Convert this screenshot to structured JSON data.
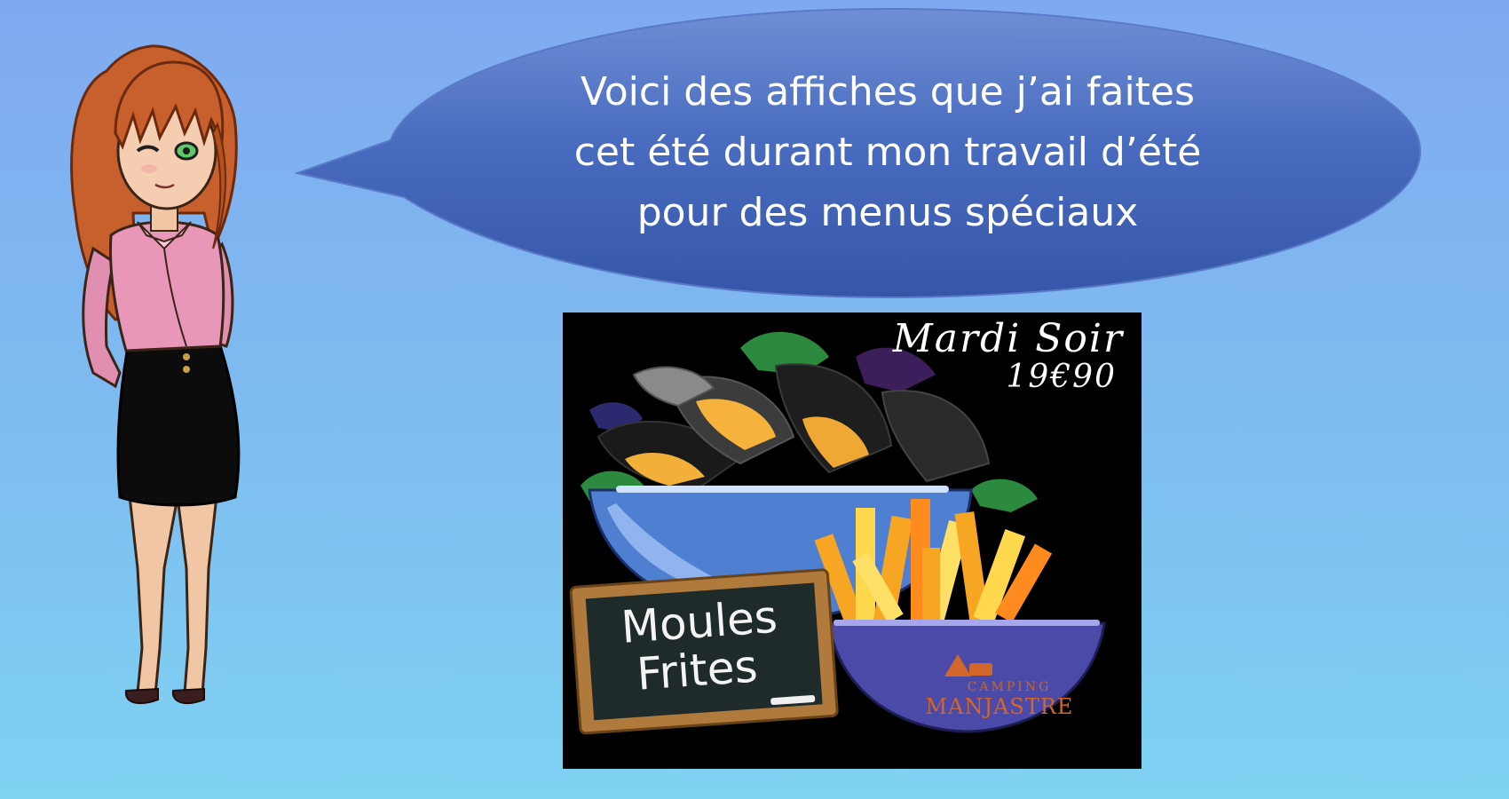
{
  "speech_bubble": {
    "lines": [
      "Voici des affiches que j’ai faites",
      "cet été durant mon travail d’été",
      "pour des menus spéciaux"
    ]
  },
  "poster": {
    "title": "Mardi Soir",
    "price": "19€90",
    "chalkboard_lines": [
      "Moules",
      "Frites"
    ],
    "logo": {
      "camping_label": "CAMPING",
      "name": "MANJASTRE"
    }
  },
  "colors": {
    "background_top": "#80aaf0",
    "background_bottom": "#7fd2f2",
    "bubble": "#3d62b4",
    "poster_background": "#000000",
    "logo_orange": "#d2672a"
  }
}
